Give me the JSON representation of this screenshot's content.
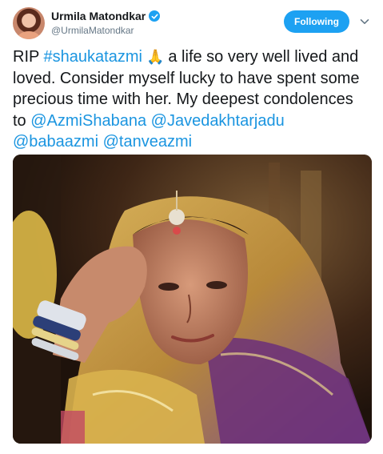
{
  "user": {
    "display_name": "Urmila Matondkar",
    "handle": "@UrmilaMatondkar",
    "verified": true
  },
  "follow_button": {
    "label": "Following"
  },
  "tweet": {
    "segments": [
      {
        "text": "RIP ",
        "link": false
      },
      {
        "text": "#shaukatazmi",
        "link": true
      },
      {
        "text": " 🙏 ",
        "link": false,
        "emoji": true
      },
      {
        "text": "a life so very well lived and loved. Consider myself lucky to have spent some precious time with her. My deepest condolences to ",
        "link": false
      },
      {
        "text": "@AzmiShabana",
        "link": true
      },
      {
        "text": " ",
        "link": false
      },
      {
        "text": "@Javedakhtarjadu",
        "link": true
      },
      {
        "text": " ",
        "link": false
      },
      {
        "text": "@babaazmi",
        "link": true
      },
      {
        "text": " ",
        "link": false
      },
      {
        "text": "@tanveazmi",
        "link": true
      }
    ]
  },
  "colors": {
    "accent": "#1da1f2",
    "link": "#1b95e0",
    "text": "#14171a",
    "secondary": "#657786"
  },
  "icons": {
    "verified": "verified-badge-icon",
    "menu": "chevron-down-icon"
  }
}
